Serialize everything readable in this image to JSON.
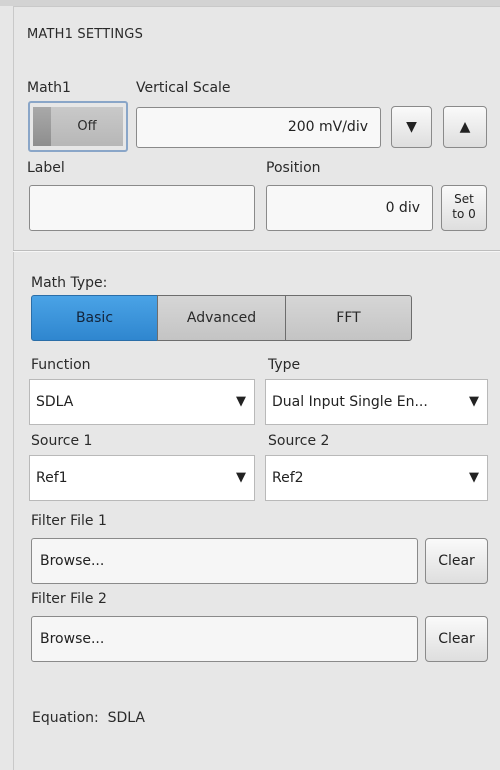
{
  "panel": {
    "title": "MATH1 SETTINGS"
  },
  "math1": {
    "label": "Math1",
    "toggle_state": "Off"
  },
  "vertical_scale": {
    "label": "Vertical Scale",
    "value": "200 mV/div"
  },
  "label_field": {
    "label": "Label",
    "value": ""
  },
  "position": {
    "label": "Position",
    "value": "0 div",
    "set_to_zero_line1": "Set",
    "set_to_zero_line2": "to 0"
  },
  "math_type": {
    "label": "Math Type:",
    "options": [
      "Basic",
      "Advanced",
      "FFT"
    ],
    "selected": "Basic"
  },
  "function": {
    "label": "Function",
    "value": "SDLA"
  },
  "type": {
    "label": "Type",
    "value": "Dual Input Single En..."
  },
  "source1": {
    "label": "Source 1",
    "value": "Ref1"
  },
  "source2": {
    "label": "Source 2",
    "value": "Ref2"
  },
  "filter1": {
    "label": "Filter File 1",
    "value": "Browse...",
    "clear": "Clear"
  },
  "filter2": {
    "label": "Filter File 2",
    "value": "Browse...",
    "clear": "Clear"
  },
  "equation": {
    "label": "Equation:",
    "value": "SDLA"
  },
  "icons": {
    "dropdown": "▼",
    "scale_down": "▼",
    "scale_up": "▲"
  },
  "colors": {
    "selected_blue": "#3a8fd6",
    "background": "#e7e7e7"
  }
}
